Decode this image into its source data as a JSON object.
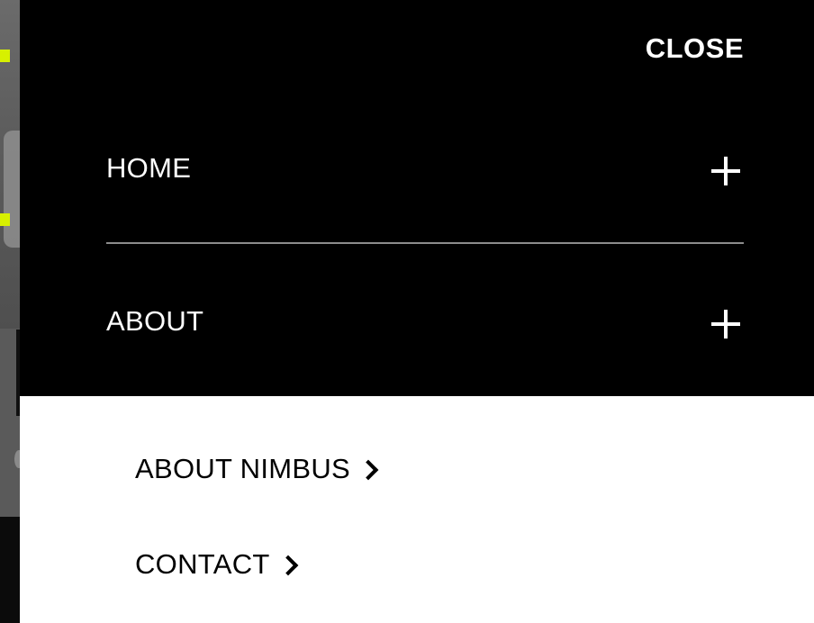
{
  "menu": {
    "close_label": "CLOSE",
    "items": [
      {
        "label": "HOME",
        "icon": "plus-icon",
        "expanded": false
      },
      {
        "label": "ABOUT",
        "icon": "plus-icon",
        "expanded": true
      }
    ],
    "submenu": [
      {
        "label": "ABOUT NIMBUS",
        "icon": "chevron-right-icon"
      },
      {
        "label": "CONTACT",
        "icon": "chevron-right-icon"
      }
    ]
  },
  "colors": {
    "panel_bg": "#000000",
    "submenu_bg": "#ffffff",
    "accent": "#d7f000",
    "divider": "#8c8c8c"
  }
}
